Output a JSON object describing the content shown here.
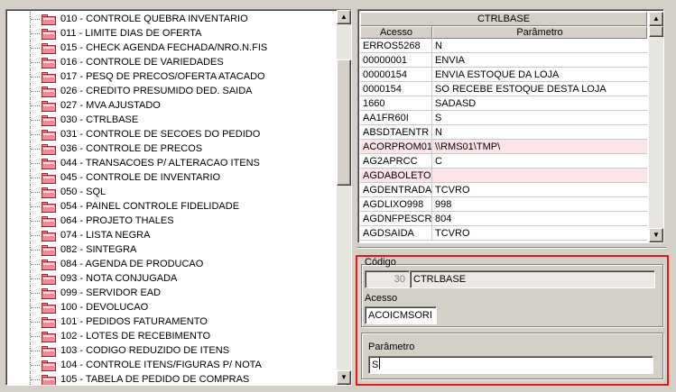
{
  "tree": {
    "items": [
      "010 - CONTROLE QUEBRA INVENTARIO",
      "011 - LIMITE DIAS DE OFERTA",
      "015 - CHECK AGENDA FECHADA/NRO.N.FIS",
      "016 - CONTROLE DE VARIEDADES",
      "017 - PESQ DE PRECOS/OFERTA ATACADO",
      "026 - CREDITO PRESUMIDO DED. SAIDA",
      "027 - MVA AJUSTADO",
      "030 - CTRLBASE",
      "031 - CONTROLE DE SECOES DO PEDIDO",
      "036 - CONTROLE DE PRECOS",
      "044 - TRANSACOES P/ ALTERACAO ITENS",
      "045 - CONTROLE DE INVENTARIO",
      "050 - SQL",
      "054 - PAINEL CONTROLE FIDELIDADE",
      "064 - PROJETO THALES",
      "074 - LISTA NEGRA",
      "082 - SINTEGRA",
      "084 - AGENDA DE PRODUCAO",
      "093 - NOTA CONJUGADA",
      "099 - SERVIDOR EAD",
      "100 - DEVOLUCAO",
      "101 - PEDIDOS FATURAMENTO",
      "102 - LOTES DE RECEBIMENTO",
      "103 - CODIGO REDUZIDO DE ITENS",
      "104 - CONTROLE ITENS/FIGURAS P/ NOTA",
      "105 - TABELA DE PEDIDO DE COMPRAS"
    ]
  },
  "grid": {
    "title": "CTRLBASE",
    "columns": [
      "Acesso",
      "Parâmetro"
    ],
    "rows": [
      {
        "acesso": "ERROS5268",
        "parametro": "N",
        "highlight": false
      },
      {
        "acesso": "00000001",
        "parametro": "ENVIA",
        "highlight": false
      },
      {
        "acesso": "00000154",
        "parametro": "ENVIA ESTOQUE DA LOJA",
        "highlight": false
      },
      {
        "acesso": "0000154",
        "parametro": "SO RECEBE ESTOQUE DESTA LOJA",
        "highlight": false
      },
      {
        "acesso": "1660",
        "parametro": "SADASD",
        "highlight": false
      },
      {
        "acesso": "AA1FR60I",
        "parametro": "S",
        "highlight": false
      },
      {
        "acesso": "ABSDTAENTR",
        "parametro": "N",
        "highlight": false
      },
      {
        "acesso": "ACORPROM01",
        "parametro": "\\\\RMS01\\TMP\\",
        "highlight": true
      },
      {
        "acesso": "AG2APRCC",
        "parametro": "C",
        "highlight": false
      },
      {
        "acesso": "AGDABOLETO",
        "parametro": "",
        "highlight": true
      },
      {
        "acesso": "AGDENTRADA",
        "parametro": "TCVRO",
        "highlight": false
      },
      {
        "acesso": "AGDLIXO998",
        "parametro": "998",
        "highlight": false
      },
      {
        "acesso": "AGDNFPESCR",
        "parametro": "804",
        "highlight": false
      },
      {
        "acesso": "AGDSAIDA",
        "parametro": "TCVRO",
        "highlight": false
      }
    ]
  },
  "form": {
    "codigo_label": "Código",
    "codigo_number": "30",
    "codigo_name": "CTRLBASE",
    "acesso_label": "Acesso",
    "acesso_value": "ACOICMSORI",
    "parametro_label": "Parâmetro",
    "parametro_value": "S"
  },
  "icons": {
    "scroll_up": "▲",
    "scroll_down": "▼",
    "folder": "folder-icon"
  },
  "colors": {
    "highlight_row": "#fce4e8",
    "focus_border": "#e8141c",
    "window_bg": "#d4d0c8"
  }
}
